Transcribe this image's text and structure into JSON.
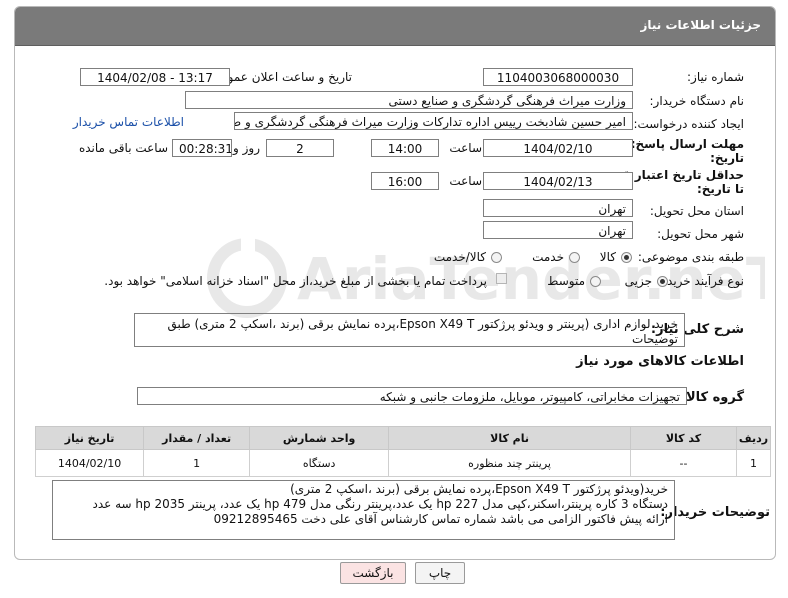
{
  "header": {
    "title": "جزئیات اطلاعات نیاز"
  },
  "fields": {
    "need_number_label": "شماره نیاز:",
    "need_number": "1104003068000030",
    "announce_label": "تاریخ و ساعت اعلان عمومی:",
    "announce_value": "1404/02/08 - 13:17",
    "buyer_org_label": "نام دستگاه خریدار:",
    "buyer_org": "وزارت میراث فرهنگی  گردشگری و صنایع دستی",
    "creator_label": "ایجاد کننده درخواست:",
    "creator": "امیر حسین شادبخت رییس اداره تدارکات وزارت میراث فرهنگی  گردشگری و صنایع دستی",
    "contact_link": "اطلاعات تماس خریدار",
    "deadline_label_1": "مهلت ارسال پاسخ: تا",
    "deadline_label_2": "تاریخ:",
    "deadline_date": "1404/02/10",
    "time_label": "ساعت",
    "deadline_time": "14:00",
    "days_count": "2",
    "days_label": "روز و",
    "remaining_time": "00:28:31",
    "remaining_label": "ساعت باقی مانده",
    "min_price_label_1": "حداقل تاریخ اعتبار قیمت:",
    "min_price_label_2": "تا تاریخ:",
    "min_price_date": "1404/02/13",
    "min_price_time": "16:00",
    "province_label": "استان محل تحویل:",
    "province": "تهران",
    "city_label": "شهر محل تحویل:",
    "city": "تهران",
    "category_label": "طبقه بندی موضوعی:",
    "category_options": [
      "کالا",
      "خدمت",
      "کالا/خدمت"
    ],
    "category_selected": "کالا",
    "process_label": "نوع فرآیند خرید :",
    "process_options": [
      "جزیی",
      "متوسط"
    ],
    "process_selected": "جزیی",
    "payment_note": "پرداخت تمام یا بخشی از مبلغ خرید،از محل \"اسناد خزانه اسلامی\" خواهد بود."
  },
  "description": {
    "label": "شرح کلی نیاز:",
    "text": "خرید لوازم اداری (پرینتر و ویدئو پرژکتور Epson X49 T،پرده نمایش برقی (برند ،اسکپ 2 متری) طبق توضیحات"
  },
  "goods": {
    "section_title": "اطلاعات کالاهای مورد نیاز",
    "group_label": "گروه کالا:",
    "group_value": "تجهیزات مخابراتی، کامپیوتر، موبایل، ملزومات جانبی و شبکه"
  },
  "table": {
    "headers": [
      "ردیف",
      "کد کالا",
      "نام کالا",
      "واحد شمارش",
      "تعداد / مقدار",
      "تاریخ نیاز"
    ],
    "rows": [
      [
        "1",
        "--",
        "پرینتر چند منظوره",
        "دستگاه",
        "1",
        "1404/02/10"
      ]
    ]
  },
  "buyer_notes": {
    "label": "توضیحات خریدار:",
    "lines": [
      "خرید(ویدئو پرژکتور Epson X49 T،پرده نمایش برقی (برند ،اسکپ 2 متری)",
      "دستگاه 3 کاره پرینتر،اسکنر،کپی مدل hp 227 یک عدد،پرینتر رنگی مدل hp 479 یک عدد، پرینتر hp 2035 سه عدد",
      "ارائه پیش فاکتور الزامی می باشد شماره تماس کارشناس آقای علی دخت 09212895465"
    ]
  },
  "buttons": {
    "print": "چاپ",
    "back": "بازگشت"
  },
  "watermark_text": "AriaTender.neT",
  "colors": {
    "header_bg": "#7a7a7a",
    "link": "#1a4fa8",
    "back_button": "#fbe3e3"
  }
}
